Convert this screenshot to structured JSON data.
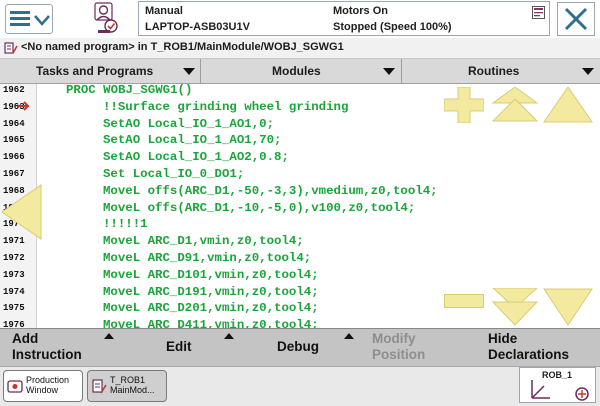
{
  "header": {
    "mode": "Manual",
    "controller": "LAPTOP-ASB03U1V",
    "motors": "Motors On",
    "state": "Stopped (Speed 100%)"
  },
  "path": "<No named program> in T_ROB1/MainModule/WOBJ_SGWG1",
  "tabs": [
    "Tasks and Programs",
    "Modules",
    "Routines"
  ],
  "code_lines": [
    {
      "n": "1962",
      "indent": 0,
      "text": "PROC WOBJ_SGWG1()"
    },
    {
      "n": "1963",
      "indent": 1,
      "text": "!!Surface grinding wheel grinding"
    },
    {
      "n": "1964",
      "indent": 1,
      "text": "SetAO Local_IO_1_AO1,0;"
    },
    {
      "n": "1965",
      "indent": 1,
      "text": "SetAO Local_IO_1_AO1,70;"
    },
    {
      "n": "1966",
      "indent": 1,
      "text": "SetAO Local_IO_1_AO2,0.8;"
    },
    {
      "n": "1967",
      "indent": 1,
      "text": "Set Local_IO_0_DO1;"
    },
    {
      "n": "1968",
      "indent": 1,
      "text": "MoveL offs(ARC_D1,-50,-3,3),vmedium,z0,tool4;"
    },
    {
      "n": "1969",
      "indent": 1,
      "text": "MoveL offs(ARC_D1,-10,-5,0),v100,z0,tool4;"
    },
    {
      "n": "1970",
      "indent": 1,
      "text": "!!!!!1"
    },
    {
      "n": "1971",
      "indent": 1,
      "text": "MoveL ARC_D1,vmin,z0,tool4;"
    },
    {
      "n": "1972",
      "indent": 1,
      "text": "MoveL ARC_D91,vmin,z0,tool4;"
    },
    {
      "n": "1973",
      "indent": 1,
      "text": "MoveL ARC_D101,vmin,z0,tool4;"
    },
    {
      "n": "1974",
      "indent": 1,
      "text": "MoveL ARC_D191,vmin,z0,tool4;"
    },
    {
      "n": "1975",
      "indent": 1,
      "text": "MoveL ARC_D201,vmin,z0,tool4;"
    },
    {
      "n": "1976",
      "indent": 1,
      "text": "MoveL ARC_D411,vmin,z0,tool4;"
    }
  ],
  "commands": {
    "add_instruction": [
      "Add",
      "Instruction"
    ],
    "edit": "Edit",
    "debug": "Debug",
    "modify_position": [
      "Modify",
      "Position"
    ],
    "hide_declarations": [
      "Hide",
      "Declarations"
    ]
  },
  "taskbar": {
    "production_window": [
      "Production",
      "Window"
    ],
    "program_editor": [
      "T_ROB1",
      "MainMod..."
    ],
    "quickset_label": "ROB_1"
  },
  "colors": {
    "code_text": "#1aa53a",
    "nav_arrows": "#f3ea9f",
    "command_bar": "#c4c4c4"
  }
}
